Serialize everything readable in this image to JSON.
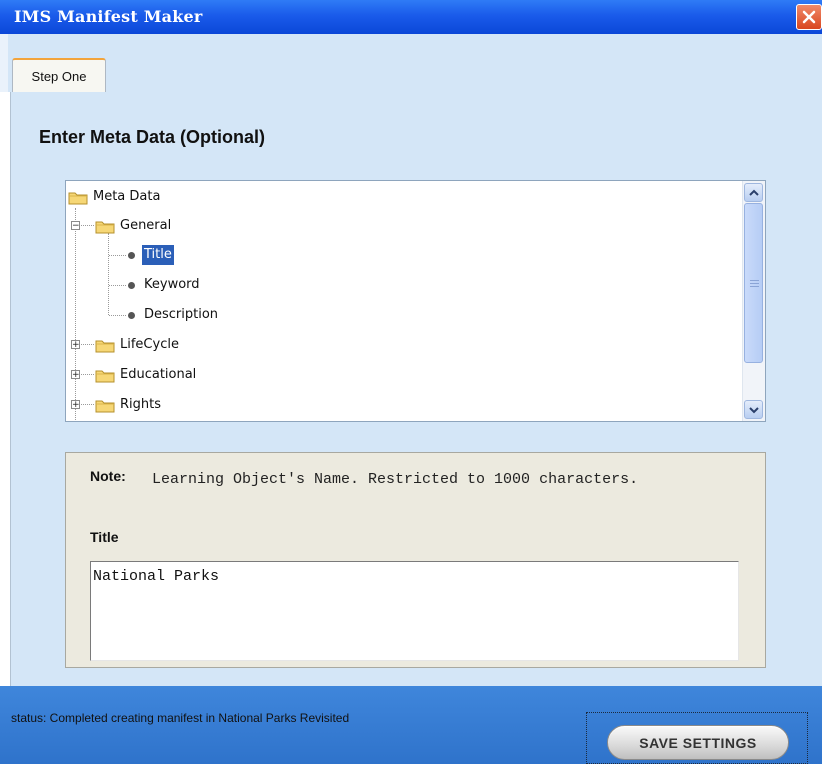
{
  "window": {
    "title": "IMS Manifest Maker"
  },
  "tabs": [
    {
      "label": "Step One",
      "active": true
    }
  ],
  "heading": "Enter Meta Data (Optional)",
  "tree": {
    "root": "Meta Data",
    "general": "General",
    "general_children": [
      "Title",
      "Keyword",
      "Description"
    ],
    "selected": "Title",
    "lifecycle": "LifeCycle",
    "educational": "Educational",
    "rights": "Rights"
  },
  "note": {
    "label": "Note:",
    "text": "Learning Object's Name.  Restricted to 1000 characters."
  },
  "field": {
    "label": "Title",
    "value": "National Parks"
  },
  "status": "status: Completed creating manifest in National Parks Revisited",
  "save_button": "SAVE SETTINGS",
  "colors": {
    "titlebar": "#1a5bea",
    "panel": "#d4e6f7",
    "statusbar": "#3a7fd6",
    "selection": "#2b5fb8"
  }
}
